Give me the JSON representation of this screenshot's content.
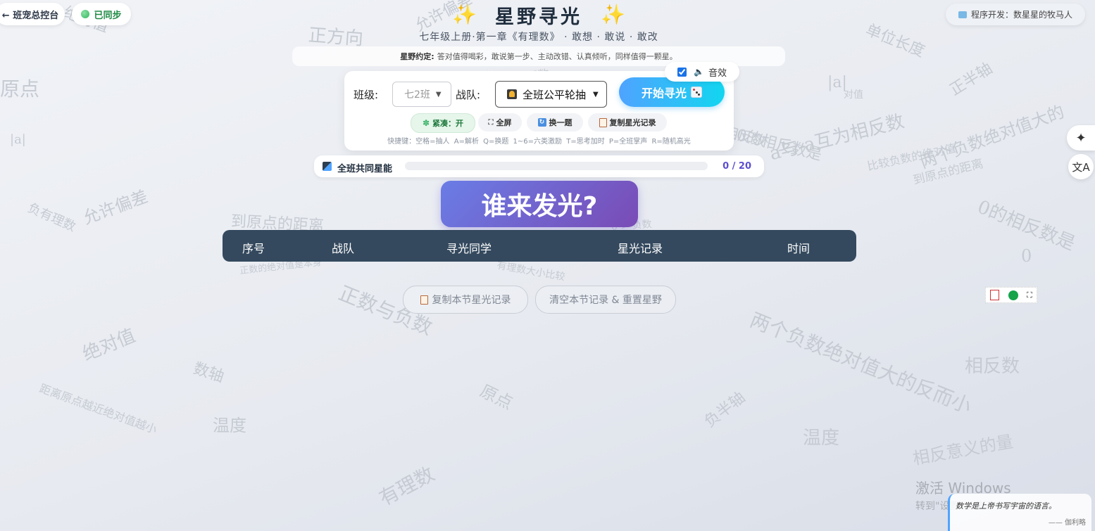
{
  "topbar": {
    "back_label": "← 班宠总控台",
    "sync_label": "已同步",
    "dev_credit": "程序开发：数星星的牧马人"
  },
  "header": {
    "sparkle_left": "✨",
    "title": "星野寻光",
    "sparkle_right": "✨",
    "subtitle": "七年级上册·第一章《有理数》 · 敢想 · 敢说 · 敢改",
    "agreement_label": "星野约定:",
    "agreement_text": "答对值得喝彩，敢说第一步、主动改错、认真倾听，同样值得一颗星。"
  },
  "controls": {
    "class_label": "班级:",
    "class_value": "七2班",
    "team_label": "战队:",
    "team_value": "全班公平轮抽",
    "start_button": "开始寻光",
    "sound_label": "音效",
    "sound_checked": true,
    "chips": {
      "compact": "紧凑：开",
      "fullscreen": "全屏",
      "switch_question": "换一题",
      "copy_record": "复制星光记录"
    },
    "hotkeys": "快捷键：空格=抽人 A=解析 Q=换题 1~6=六类激励 T=思考加时 P=全班掌声 R=随机高光"
  },
  "energy": {
    "label": "全班共同星能",
    "current": 0,
    "total": 20,
    "display": "0 / 20"
  },
  "stage": {
    "who_label": "谁来发光?"
  },
  "table": {
    "headers": [
      "序号",
      "战队",
      "寻光同学",
      "星光记录",
      "时间"
    ]
  },
  "actions": {
    "copy_session": "复制本节星光记录",
    "clear_reset": "清空本节记录 & 重置星野"
  },
  "watermarks": [
    "正方向",
    "允许偏差",
    "单位长度",
    "正半轴",
    "原点",
    "|a|",
    "0的相反数是",
    "0",
    "a与-a互为相反数",
    "两个负数绝对值大的",
    "到原点的距离",
    "比较负数的绝对值",
    "负有理数",
    "允许偏差",
    "到原点的距离",
    "正数的绝对值是本身",
    "有理数大小比较",
    "正数与负数",
    "绝对值",
    "数轴",
    "距离原点越近绝对值越小",
    "温度",
    "原点",
    "负半轴",
    "温度",
    "相反数",
    "两个负数绝对值大的反而小",
    "相反意义的量",
    "有理数",
    "|a|",
    "绝对值",
    "有理数",
    "对值",
    "相反数",
    "0的相反数是",
    "0 > 负数"
  ],
  "quote": {
    "text": "数学是上帝书写宇宙的语言。",
    "author": "—— 伽利略"
  },
  "windows_activation": {
    "title": "激活 Windows",
    "subtitle": "转到\"设置\"以激活 Windows。"
  },
  "colors": {
    "primary_blue": "#4fa3ff",
    "accent_cyan": "#12d6f0",
    "banner_purple_start": "#6a7de6",
    "banner_purple_end": "#7a4bb5",
    "table_header": "#34495e",
    "energy_value": "#5b4fd0",
    "sync_green": "#2fb85b",
    "chip_green_bg": "#e6f6ea"
  }
}
